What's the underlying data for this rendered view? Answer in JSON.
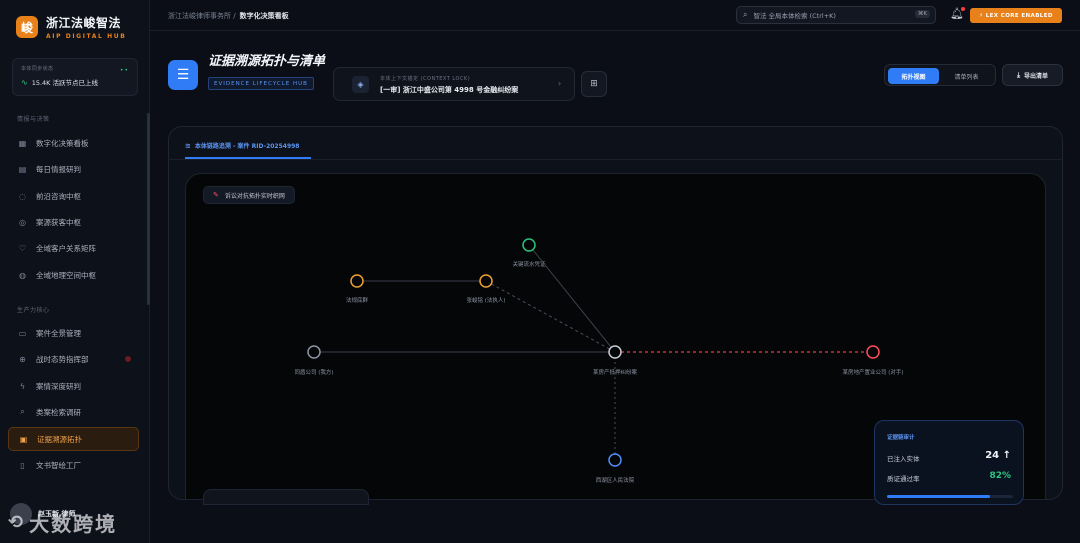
{
  "brand": {
    "logo_char": "峻",
    "title": "浙江法峻智法",
    "subtitle": "AIP DIGITAL HUB"
  },
  "status_card": {
    "label": "本体同步状态",
    "dots": "••",
    "text": "15.4K 活跃节点已上线"
  },
  "sidebar": {
    "section_intel": "情报与决策",
    "section_prod": "生产力核心",
    "items": [
      {
        "label": "数字化决策看板",
        "icon": "dashboard-icon",
        "glyph": "▦"
      },
      {
        "label": "每日情报研判",
        "icon": "calendar-icon",
        "glyph": "▤"
      },
      {
        "label": "前沿咨询中枢",
        "icon": "chat-icon",
        "glyph": "◌"
      },
      {
        "label": "案源获客中枢",
        "icon": "target-icon",
        "glyph": "◎"
      },
      {
        "label": "全域客户关系矩阵",
        "icon": "heart-icon",
        "glyph": "♡"
      },
      {
        "label": "全域地理空间中枢",
        "icon": "globe-icon",
        "glyph": "◍"
      },
      {
        "label": "案件全景管理",
        "icon": "clipboard-icon",
        "glyph": "▭"
      },
      {
        "label": "战时态势指挥部",
        "icon": "crosshair-icon",
        "glyph": "⊕"
      },
      {
        "label": "案情深度研判",
        "icon": "bolt-icon",
        "glyph": "ϟ"
      },
      {
        "label": "类案检索调研",
        "icon": "search-icon",
        "glyph": "⌕"
      },
      {
        "label": "证据溯源拓扑",
        "icon": "evidence-icon",
        "glyph": "▣"
      },
      {
        "label": "文书智绘工厂",
        "icon": "document-icon",
        "glyph": "▯"
      }
    ]
  },
  "user": {
    "name": "赵玉新 律师"
  },
  "watermark": {
    "text": "大数跨境",
    "logo": "⟲"
  },
  "topbar": {
    "crumb_parent": "浙江法峻律师事务所 /",
    "crumb_current": "数字化决策看板",
    "search_placeholder": "智法 全局本体检索 (Ctrl+K)",
    "search_kbd": "⌘K",
    "badge": "⚡ LEX CORE ENABLED"
  },
  "header": {
    "icon_glyph": "☰",
    "title": "证据溯源拓扑与清单",
    "tag": "EVIDENCE LIFECYCLE HUB",
    "context_label": "本体上下文锚定 (CONTEXT LOCK)",
    "context_value": "[一审] 浙江中盛公司第 4998 号金融纠纷案",
    "view_topology": "拓扑视图",
    "view_list": "清单列表",
    "export": "导出清单"
  },
  "tab": {
    "label": "本体链路追溯 - 案件 RID-20254998"
  },
  "graph": {
    "live_label": "诉讼对抗拓扑实时织网",
    "nodes": [
      {
        "id": "center",
        "label": "某房产抵押纠纷案",
        "color": "#c8ccd4"
      },
      {
        "id": "bank_flow",
        "label": "关键流水凭证",
        "color": "#2ec27e"
      },
      {
        "id": "legal_rep",
        "label": "法规底群",
        "color": "#f0a030"
      },
      {
        "id": "witness",
        "label": "张峻铭 (法执人)",
        "color": "#f0a030"
      },
      {
        "id": "our_company",
        "label": "同盾公司 (我方)",
        "color": "#8d95a4"
      },
      {
        "id": "opponent",
        "label": "某房地产置业公司 (对手)",
        "color": "#ff4d5e"
      },
      {
        "id": "court",
        "label": "西湖区人民法院",
        "color": "#4d8ef7"
      }
    ]
  },
  "stats": {
    "title": "证据链审计",
    "injected_label": "已注入实体",
    "injected_value": "24 ↑",
    "pass_label": "质证通过率",
    "pass_value": "82%",
    "pass_fraction": 0.82
  }
}
